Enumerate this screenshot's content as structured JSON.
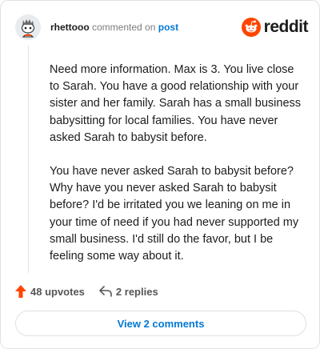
{
  "header": {
    "username": "rhettooo",
    "action_text": "commented on",
    "target_text": "post",
    "brand": "reddit"
  },
  "comment": {
    "paragraphs": [
      "Need more information. Max is 3. You live close to Sarah. You have a good relationship with your sister and her family. Sarah has a small business babysitting for local families. You have never asked Sarah to babysit before.",
      "You have never asked Sarah to babysit before? Why have you never asked Sarah to babysit before? I'd be irritated you we leaning on me in your time of need if you had never supported my small business. I'd still do the favor, but I be feeling some way about it."
    ]
  },
  "actions": {
    "upvotes": "48 upvotes",
    "replies": "2 replies"
  },
  "footer": {
    "view_comments": "View 2 comments"
  },
  "colors": {
    "accent": "#0079d3",
    "upvote": "#ff4500",
    "brand": "#ff4500"
  },
  "icons": {
    "avatar": "snoo-avatar",
    "logo": "reddit-logo-icon",
    "upvote": "upvote-arrow-icon",
    "reply": "reply-arrow-icon"
  }
}
